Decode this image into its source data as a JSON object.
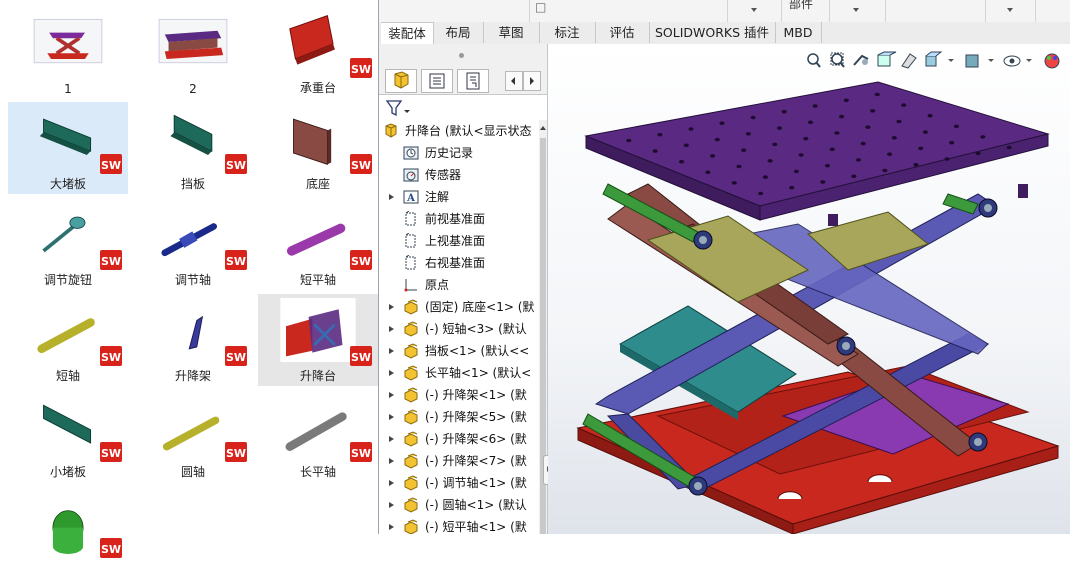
{
  "browser": {
    "files": [
      {
        "name": "1",
        "icon": "assembly-thumb-1"
      },
      {
        "name": "2",
        "icon": "assembly-thumb-2"
      },
      {
        "name": "承重台",
        "icon": "part-承重台"
      },
      {
        "name": "大堵板",
        "icon": "part-大堵板",
        "selected": true
      },
      {
        "name": "挡板",
        "icon": "part-挡板"
      },
      {
        "name": "底座",
        "icon": "part-底座"
      },
      {
        "name": "调节旋钮",
        "icon": "part-调节旋钮"
      },
      {
        "name": "调节轴",
        "icon": "part-调节轴"
      },
      {
        "name": "短平轴",
        "icon": "part-短平轴"
      },
      {
        "name": "短轴",
        "icon": "part-短轴"
      },
      {
        "name": "升降架",
        "icon": "part-升降架"
      },
      {
        "name": "升降台",
        "icon": "assembly-升降台",
        "highlighted": true
      },
      {
        "name": "小堵板",
        "icon": "part-小堵板"
      },
      {
        "name": "圆轴",
        "icon": "part-圆轴"
      },
      {
        "name": "长平轴",
        "icon": "part-长平轴"
      },
      {
        "name": "",
        "icon": "part-roller"
      }
    ]
  },
  "solidworks": {
    "topbar": {
      "title": "部件",
      "glyph": "□"
    },
    "tabs": [
      "装配体",
      "布局",
      "草图",
      "标注",
      "评估",
      "SOLIDWORKS 插件",
      "MBD"
    ],
    "active_tab": "装配体",
    "tree": [
      {
        "label": "升降台 (默认<显示状态",
        "icon": "assembly-icon",
        "expander": "",
        "indent": 0
      },
      {
        "label": "历史记录",
        "icon": "history-icon",
        "expander": "",
        "indent": 1
      },
      {
        "label": "传感器",
        "icon": "sensor-icon",
        "expander": "",
        "indent": 1
      },
      {
        "label": "注解",
        "icon": "annotation-icon",
        "expander": "▸",
        "indent": 1
      },
      {
        "label": "前视基准面",
        "icon": "plane-icon",
        "expander": "",
        "indent": 1
      },
      {
        "label": "上视基准面",
        "icon": "plane-icon",
        "expander": "",
        "indent": 1
      },
      {
        "label": "右视基准面",
        "icon": "plane-icon",
        "expander": "",
        "indent": 1
      },
      {
        "label": "原点",
        "icon": "origin-icon",
        "expander": "",
        "indent": 1
      },
      {
        "label": "(固定) 底座<1> (默",
        "icon": "part-icon",
        "expander": "▸",
        "indent": 1
      },
      {
        "label": "(-) 短轴<3> (默认",
        "icon": "part-icon",
        "expander": "▸",
        "indent": 1
      },
      {
        "label": "挡板<1> (默认<<",
        "icon": "part-icon",
        "expander": "▸",
        "indent": 1
      },
      {
        "label": "长平轴<1> (默认<",
        "icon": "part-icon",
        "expander": "▸",
        "indent": 1
      },
      {
        "label": "(-) 升降架<1> (默",
        "icon": "part-icon",
        "expander": "▸",
        "indent": 1
      },
      {
        "label": "(-) 升降架<5> (默",
        "icon": "part-icon",
        "expander": "▸",
        "indent": 1
      },
      {
        "label": "(-) 升降架<6> (默",
        "icon": "part-icon",
        "expander": "▸",
        "indent": 1
      },
      {
        "label": "(-) 升降架<7> (默",
        "icon": "part-icon",
        "expander": "▸",
        "indent": 1
      },
      {
        "label": "(-) 调节轴<1> (默",
        "icon": "part-icon",
        "expander": "▸",
        "indent": 1
      },
      {
        "label": "(-) 圆轴<1> (默认",
        "icon": "part-icon",
        "expander": "▸",
        "indent": 1
      },
      {
        "label": "(-) 短平轴<1> (默",
        "icon": "part-icon",
        "expander": "▸",
        "indent": 1
      }
    ],
    "colors": {
      "top_plate": "#5a2a82",
      "base": "#c8281e",
      "arms": "#5a5ab4",
      "links": "#8a4a44",
      "plates": "#2e8c8c",
      "shafts": "#3c9a3c"
    }
  }
}
